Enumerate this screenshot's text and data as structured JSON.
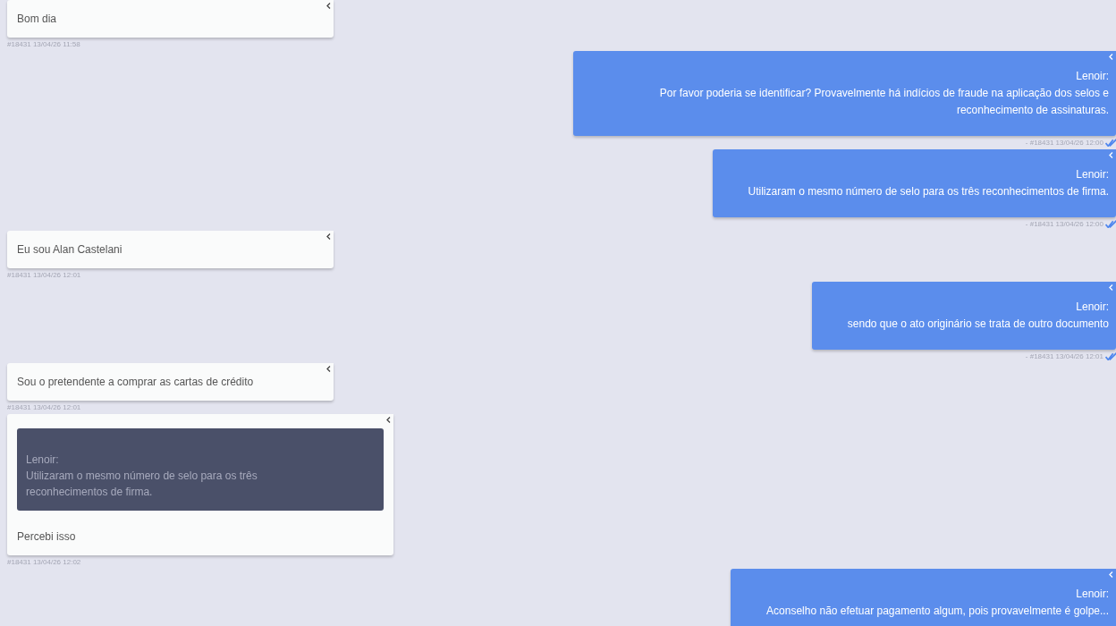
{
  "messages": [
    {
      "kind": "in",
      "text": "Bom dia",
      "meta": "#18431 13/04/26 11:58"
    },
    {
      "kind": "out",
      "sender": "Lenoir:",
      "text": "Por favor poderia se identificar? Provavelmente há indícios de fraude na aplicação dos selos e reconhecimento de assinaturas.",
      "meta": "- #18431 13/04/26 12:00",
      "read": true
    },
    {
      "kind": "out",
      "sender": "Lenoir:",
      "text": "Utilizaram o mesmo número de selo para os três reconhecimentos de firma.",
      "meta": "- #18431 13/04/26 12:00",
      "read": true
    },
    {
      "kind": "in",
      "text": "Eu sou Alan Castelani",
      "meta": "#18431 13/04/26 12:01"
    },
    {
      "kind": "out",
      "sender": "Lenoir:",
      "text": "sendo que o ato originário se trata de outro documento",
      "meta": "- #18431 13/04/26 12:01",
      "read": true
    },
    {
      "kind": "in",
      "text": "Sou o pretendente a comprar as cartas de crédito",
      "meta": "#18431 13/04/26 12:01"
    },
    {
      "kind": "in",
      "quote": {
        "sender": "Lenoir:",
        "text": "Utilizaram o mesmo número de selo para os três reconhecimentos de firma."
      },
      "text": "Percebi isso",
      "meta": "#18431 13/04/26 12:02"
    },
    {
      "kind": "out",
      "sender": "Lenoir:",
      "text": "Aconselho não efetuar pagamento algum, pois provavelmente é golpe..."
    }
  ]
}
